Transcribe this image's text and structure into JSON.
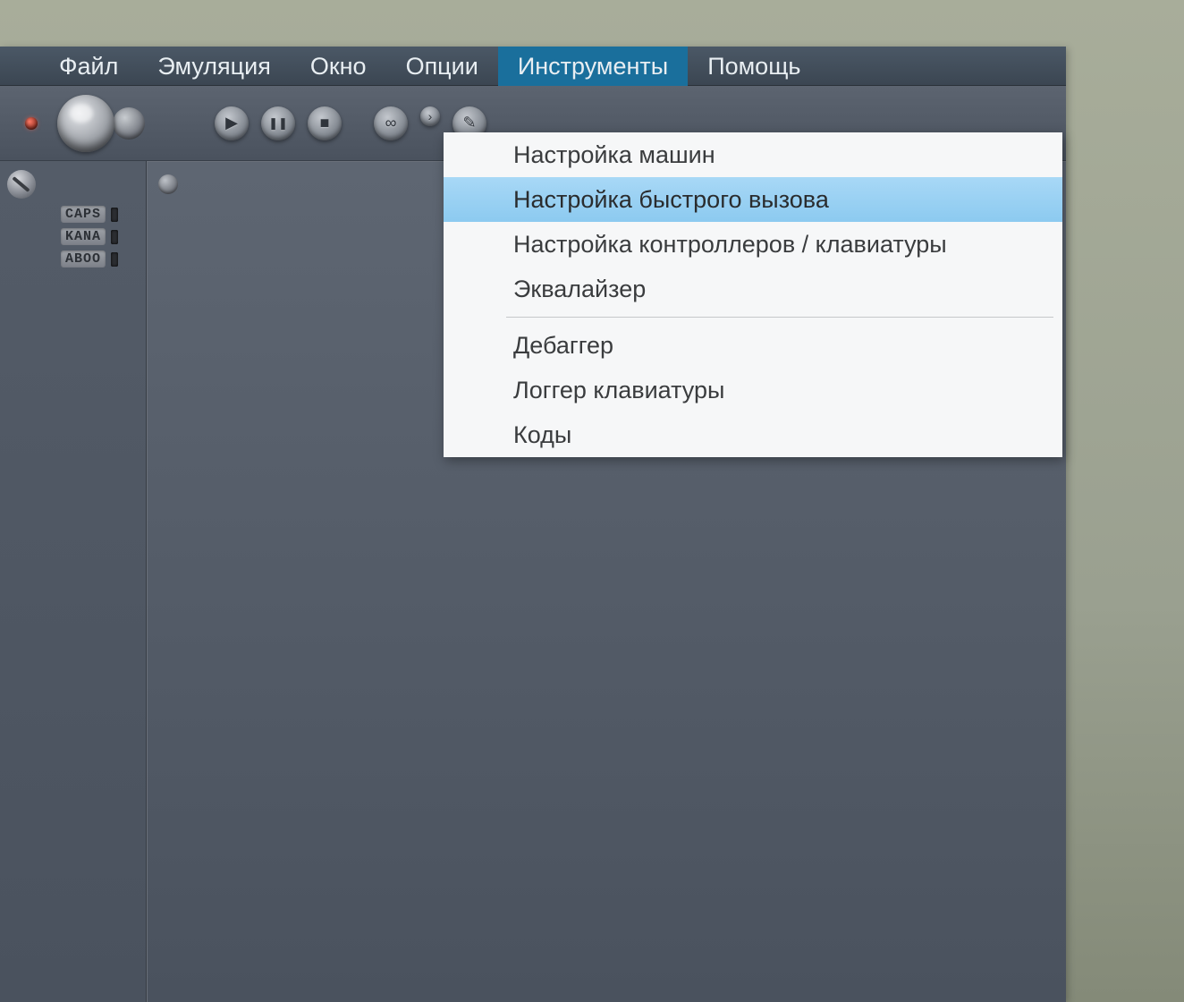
{
  "menubar": {
    "items": [
      {
        "label": "Файл"
      },
      {
        "label": "Эмуляция"
      },
      {
        "label": "Окно"
      },
      {
        "label": "Опции"
      },
      {
        "label": "Инструменты",
        "active": true
      },
      {
        "label": "Помощь"
      }
    ]
  },
  "dropdown": {
    "groups": [
      [
        {
          "label": "Настройка машин"
        },
        {
          "label": "Настройка быстрого вызова",
          "highlight": true
        },
        {
          "label": "Настройка контроллеров / клавиатуры"
        },
        {
          "label": "Эквалайзер"
        }
      ],
      [
        {
          "label": "Дебаггер"
        },
        {
          "label": "Логгер клавиатуры"
        },
        {
          "label": "Коды"
        }
      ]
    ]
  },
  "indicators": [
    {
      "label": "CAPS"
    },
    {
      "label": "KANA"
    },
    {
      "label": "ABOO"
    }
  ],
  "toolbar": {
    "play": "▶",
    "pause": "❚❚",
    "stop": "■",
    "link": "∞",
    "more": "›",
    "edit": "✎"
  }
}
